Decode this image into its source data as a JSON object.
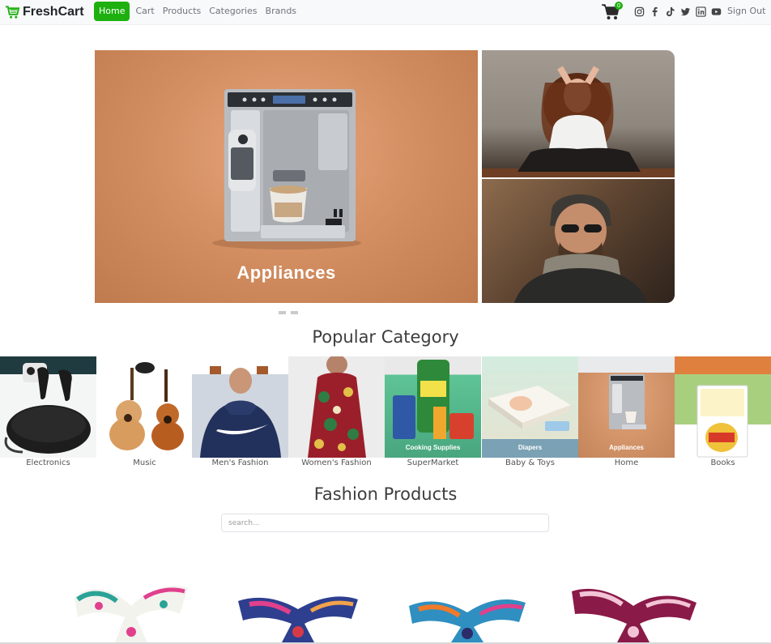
{
  "brand": {
    "name": "FreshCart",
    "accent": "#1db00f"
  },
  "nav": {
    "links": [
      {
        "label": "Home",
        "active": true
      },
      {
        "label": "Cart",
        "active": false
      },
      {
        "label": "Products",
        "active": false
      },
      {
        "label": "Categories",
        "active": false
      },
      {
        "label": "Brands",
        "active": false
      }
    ],
    "cart_count": "0",
    "socials": [
      "instagram-icon",
      "facebook-icon",
      "tiktok-icon",
      "twitter-icon",
      "linkedin-icon",
      "youtube-icon"
    ],
    "signout_label": "Sign Out"
  },
  "hero": {
    "caption": "Appliances",
    "slide_count": 2
  },
  "popular": {
    "title": "Popular Category",
    "categories": [
      {
        "label": "Electronics"
      },
      {
        "label": "Music"
      },
      {
        "label": "Men's Fashion"
      },
      {
        "label": "Women's Fashion"
      },
      {
        "label": "SuperMarket",
        "overlay": "Cooking Supplies"
      },
      {
        "label": "Baby & Toys",
        "overlay": "Diapers"
      },
      {
        "label": "Home",
        "overlay": "Appliances"
      },
      {
        "label": "Books"
      }
    ]
  },
  "fashion": {
    "title": "Fashion Products",
    "search_placeholder": "search..."
  }
}
